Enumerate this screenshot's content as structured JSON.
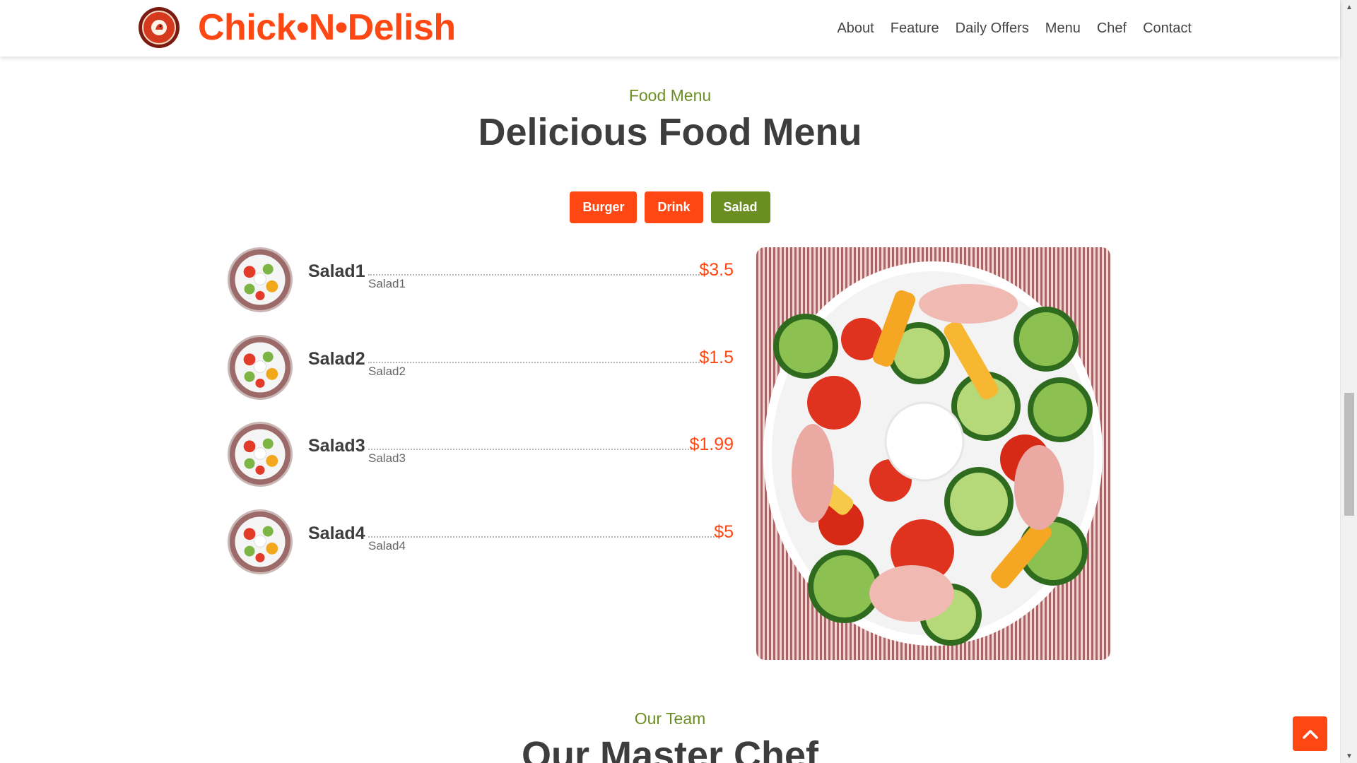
{
  "header": {
    "brand": "Chick•N•Delish",
    "nav": [
      "About",
      "Feature",
      "Daily Offers",
      "Menu",
      "Chef",
      "Contact"
    ]
  },
  "menu_section": {
    "subtitle": "Food Menu",
    "title": "Delicious Food Menu",
    "tabs": [
      {
        "label": "Burger",
        "active": false
      },
      {
        "label": "Drink",
        "active": false
      },
      {
        "label": "Salad",
        "active": true
      }
    ],
    "items": [
      {
        "name": "Salad1",
        "description": "Salad1",
        "price": "$3.5"
      },
      {
        "name": "Salad2",
        "description": "Salad2",
        "price": "$1.5"
      },
      {
        "name": "Salad3",
        "description": "Salad3",
        "price": "$1.99"
      },
      {
        "name": "Salad4",
        "description": "Salad4",
        "price": "$5"
      }
    ]
  },
  "team_section": {
    "subtitle": "Our Team",
    "title": "Our Master Chef"
  },
  "colors": {
    "brand": "#ff4713",
    "accent": "#6b8e23",
    "text": "#3d3d3d"
  },
  "icons": {
    "logo": "chicken-logo-icon",
    "back_to_top": "chevron-up-icon"
  }
}
